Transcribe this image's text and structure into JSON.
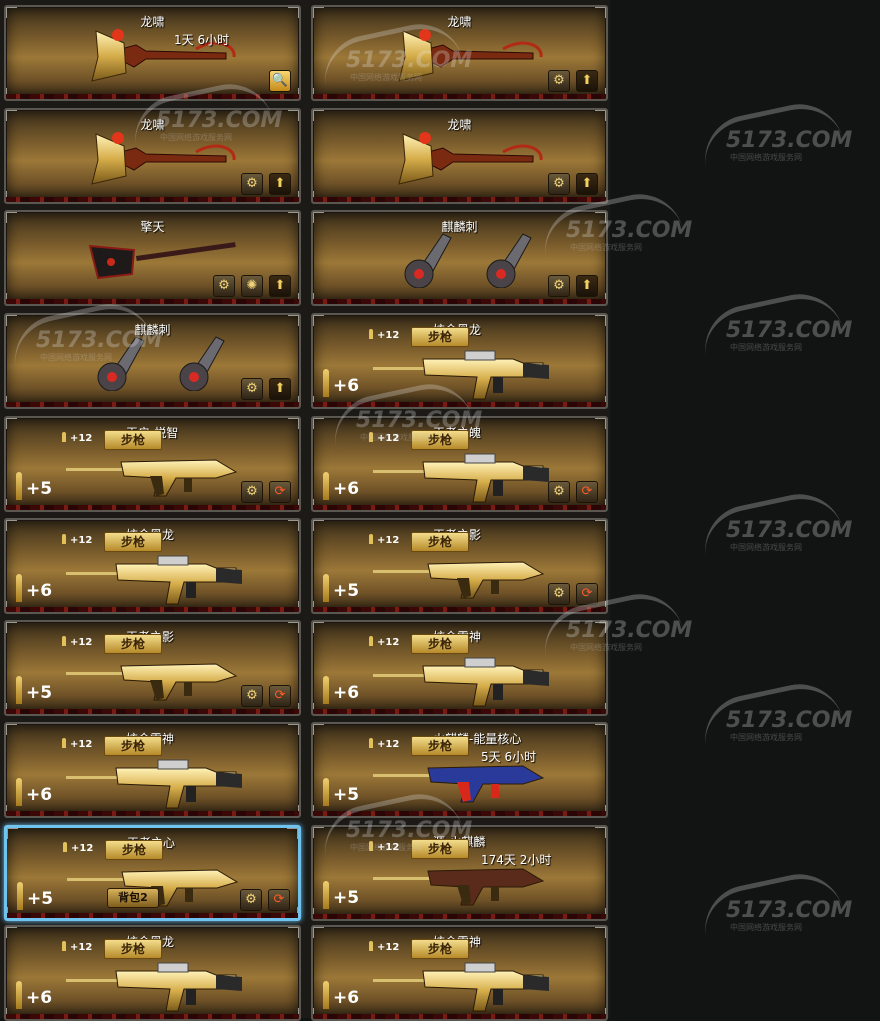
{
  "watermark": {
    "text": "5173.COM",
    "sub": "中国网络游戏服务网"
  },
  "cards": [
    {
      "name": "龙啸",
      "timer": "1天  6小时",
      "kind": "melee",
      "weapon": "axe",
      "buttons": [
        "magnify"
      ]
    },
    {
      "name": "龙啸",
      "kind": "melee",
      "weapon": "axe",
      "buttons": [
        "arrow",
        "settings"
      ]
    },
    {
      "name": "龙啸",
      "kind": "melee",
      "weapon": "axe",
      "buttons": [
        "arrow",
        "settings"
      ]
    },
    {
      "name": "龙啸",
      "kind": "melee",
      "weapon": "axe",
      "buttons": [
        "arrow",
        "settings"
      ]
    },
    {
      "name": "擎天",
      "kind": "melee",
      "weapon": "shovel",
      "buttons": [
        "arrow",
        "gear",
        "settings"
      ]
    },
    {
      "name": "麒麟刺",
      "kind": "melee",
      "weapon": "claws",
      "buttons": [
        "arrow",
        "settings"
      ]
    },
    {
      "name": "麒麟刺",
      "kind": "melee",
      "weapon": "claws",
      "buttons": [
        "arrow",
        "settings"
      ]
    },
    {
      "name": "炫金黑龙",
      "kind": "gun",
      "ammo": "+12",
      "type": "步枪",
      "rounds": "+6",
      "weapon": "m4",
      "buttons": []
    },
    {
      "name": "天启-悦智",
      "kind": "gun",
      "ammo": "+12",
      "type": "步枪",
      "rounds": "+5",
      "weapon": "ak",
      "buttons": [
        "refresh",
        "settings"
      ]
    },
    {
      "name": "王者之魄",
      "kind": "gun",
      "ammo": "+12",
      "type": "步枪",
      "rounds": "+6",
      "weapon": "m4",
      "buttons": [
        "refresh",
        "settings"
      ]
    },
    {
      "name": "炫金黑龙",
      "kind": "gun",
      "ammo": "+12",
      "type": "步枪",
      "rounds": "+6",
      "weapon": "m4",
      "buttons": []
    },
    {
      "name": "王者之影",
      "kind": "gun",
      "ammo": "+12",
      "type": "步枪",
      "rounds": "+5",
      "weapon": "ak",
      "buttons": [
        "refresh",
        "settings"
      ]
    },
    {
      "name": "王者之影",
      "kind": "gun",
      "ammo": "+12",
      "type": "步枪",
      "rounds": "+5",
      "weapon": "ak",
      "buttons": [
        "refresh",
        "settings"
      ]
    },
    {
      "name": "炫金雷神",
      "kind": "gun",
      "ammo": "+12",
      "type": "步枪",
      "rounds": "+6",
      "weapon": "m4",
      "buttons": []
    },
    {
      "name": "炫金雷神",
      "kind": "gun",
      "ammo": "+12",
      "type": "步枪",
      "rounds": "+6",
      "weapon": "m4",
      "buttons": []
    },
    {
      "name": "火麒麟-能量核心",
      "timer": "5天  6小时",
      "kind": "gun",
      "ammo": "+12",
      "type": "步枪",
      "rounds": "+5",
      "weapon": "ak-red",
      "buttons": []
    },
    {
      "name": "王者之心",
      "kind": "gun",
      "ammo": "+12",
      "type": "步枪",
      "rounds": "+5",
      "weapon": "ak",
      "buttons": [
        "refresh",
        "settings"
      ],
      "selected": true,
      "bag": "背包2"
    },
    {
      "name": "源-火麒麟",
      "timer": "174天  2小时",
      "kind": "gun",
      "ammo": "+12",
      "type": "步枪",
      "rounds": "+5",
      "weapon": "ak-dark",
      "buttons": []
    },
    {
      "name": "炫金黑龙",
      "kind": "gun",
      "ammo": "+12",
      "type": "步枪",
      "rounds": "+6",
      "weapon": "m4",
      "buttons": []
    },
    {
      "name": "炫金雷神",
      "kind": "gun",
      "ammo": "+12",
      "type": "步枪",
      "rounds": "+6",
      "weapon": "m4",
      "buttons": []
    }
  ]
}
